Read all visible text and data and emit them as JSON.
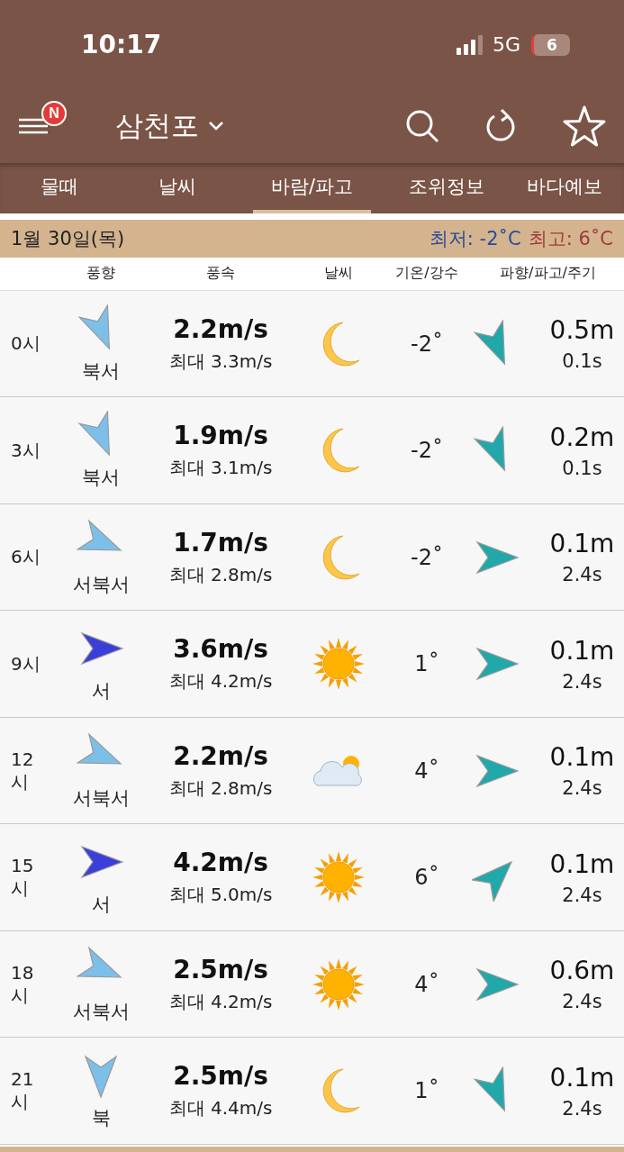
{
  "status_bar": {
    "time": "10:17",
    "network": "5G",
    "battery": "6"
  },
  "app_bar": {
    "badge": "N",
    "location": "삼천포"
  },
  "tabs": [
    {
      "label": "물때",
      "selected": false
    },
    {
      "label": "날씨",
      "selected": false
    },
    {
      "label": "바람/파고",
      "selected": true
    },
    {
      "label": "조위정보",
      "selected": false
    },
    {
      "label": "바다예보",
      "selected": false
    }
  ],
  "date_bar": {
    "date": "1월 30일(목)",
    "low": "최저: -2˚C",
    "high": "최고: 6˚C"
  },
  "columns": [
    "풍향",
    "풍속",
    "날씨",
    "기온/강수",
    "파향/파고/주기"
  ],
  "rows": [
    {
      "time": "0시",
      "wind_arrow": {
        "kind": "sse",
        "strong": false
      },
      "wind_dir": "북서",
      "speed": "2.2m/s",
      "max": "최대 3.3m/s",
      "weather": {
        "kind": "moon"
      },
      "temp": "-2˚",
      "wave_arrow": {
        "kind": "sse"
      },
      "wave_height": "0.5m",
      "wave_period": "0.1s"
    },
    {
      "time": "3시",
      "wind_arrow": {
        "kind": "sse",
        "strong": false
      },
      "wind_dir": "북서",
      "speed": "1.9m/s",
      "max": "최대 3.1m/s",
      "weather": {
        "kind": "moon"
      },
      "temp": "-2˚",
      "wave_arrow": {
        "kind": "sse"
      },
      "wave_height": "0.2m",
      "wave_period": "0.1s"
    },
    {
      "time": "6시",
      "wind_arrow": {
        "kind": "ese",
        "strong": false
      },
      "wind_dir": "서북서",
      "speed": "1.7m/s",
      "max": "최대 2.8m/s",
      "weather": {
        "kind": "moon"
      },
      "temp": "-2˚",
      "wave_arrow": {
        "kind": "e"
      },
      "wave_height": "0.1m",
      "wave_period": "2.4s"
    },
    {
      "time": "9시",
      "wind_arrow": {
        "kind": "e",
        "strong": true
      },
      "wind_dir": "서",
      "speed": "3.6m/s",
      "max": "최대 4.2m/s",
      "weather": {
        "kind": "sun"
      },
      "temp": "1˚",
      "wave_arrow": {
        "kind": "e"
      },
      "wave_height": "0.1m",
      "wave_period": "2.4s"
    },
    {
      "time": "12시",
      "wind_arrow": {
        "kind": "ese",
        "strong": false
      },
      "wind_dir": "서북서",
      "speed": "2.2m/s",
      "max": "최대 2.8m/s",
      "weather": {
        "kind": "cloud-sun"
      },
      "temp": "4˚",
      "wave_arrow": {
        "kind": "e"
      },
      "wave_height": "0.1m",
      "wave_period": "2.4s"
    },
    {
      "time": "15시",
      "wind_arrow": {
        "kind": "e",
        "strong": true
      },
      "wind_dir": "서",
      "speed": "4.2m/s",
      "max": "최대 5.0m/s",
      "weather": {
        "kind": "sun"
      },
      "temp": "6˚",
      "wave_arrow": {
        "kind": "ne"
      },
      "wave_height": "0.1m",
      "wave_period": "2.4s"
    },
    {
      "time": "18시",
      "wind_arrow": {
        "kind": "ese",
        "strong": false
      },
      "wind_dir": "서북서",
      "speed": "2.5m/s",
      "max": "최대 4.2m/s",
      "weather": {
        "kind": "sun"
      },
      "temp": "4˚",
      "wave_arrow": {
        "kind": "e"
      },
      "wave_height": "0.6m",
      "wave_period": "2.4s"
    },
    {
      "time": "21시",
      "wind_arrow": {
        "kind": "s",
        "strong": false
      },
      "wind_dir": "북",
      "speed": "2.5m/s",
      "max": "최대 4.4m/s",
      "weather": {
        "kind": "moon"
      },
      "temp": "1˚",
      "wave_arrow": {
        "kind": "sse"
      },
      "wave_height": "0.1m",
      "wave_period": "2.4s"
    }
  ]
}
